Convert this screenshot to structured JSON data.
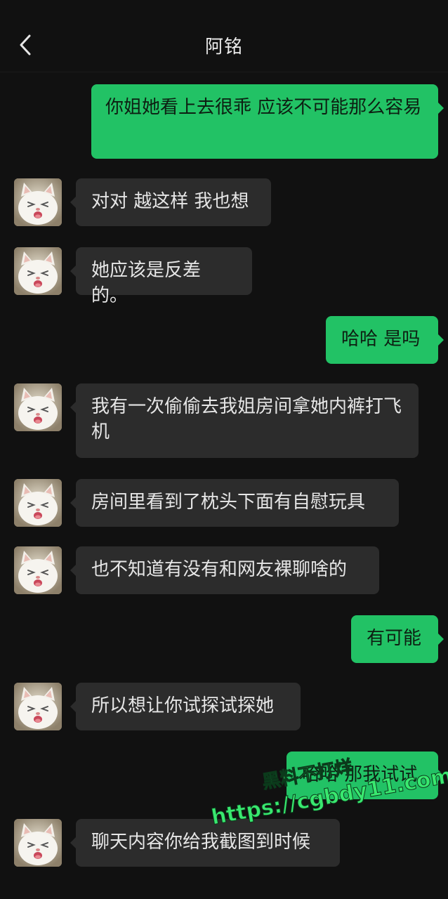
{
  "header": {
    "title": "阿铭",
    "back_icon": "chevron-left-icon"
  },
  "messages": [
    {
      "side": "out",
      "text": "你姐她看上去很乖 应该不可能那么容易"
    },
    {
      "side": "in",
      "text": "对对 越这样 我也想"
    },
    {
      "side": "in",
      "text": "她应该是反差的。"
    },
    {
      "side": "out",
      "text": "哈哈 是吗"
    },
    {
      "side": "in",
      "text": "我有一次偷偷去我姐房间拿她内裤打飞机"
    },
    {
      "side": "in",
      "text": "房间里看到了枕头下面有自慰玩具"
    },
    {
      "side": "in",
      "text": "也不知道有没有和网友裸聊啥的"
    },
    {
      "side": "out",
      "text": "有可能"
    },
    {
      "side": "in",
      "text": "所以想让你试探试探她"
    },
    {
      "side": "out",
      "text": "哈哈 那我试试"
    },
    {
      "side": "in",
      "text": "聊天内容你给我截图到时候"
    }
  ],
  "watermark": {
    "line1": "黑料不打烊",
    "line2": "https://cgbdy11.com"
  },
  "colors": {
    "background": "#111111",
    "incoming_bubble": "#2c2c2c",
    "outgoing_bubble": "#22c265",
    "watermark": "#39e86f"
  }
}
